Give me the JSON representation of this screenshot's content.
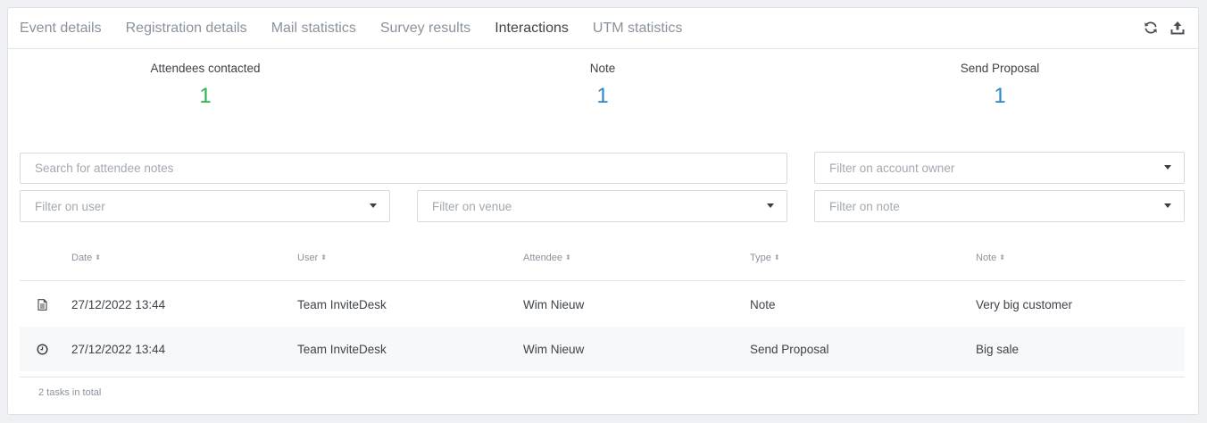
{
  "tabs": [
    {
      "label": "Event details",
      "active": false
    },
    {
      "label": "Registration details",
      "active": false
    },
    {
      "label": "Mail statistics",
      "active": false
    },
    {
      "label": "Survey results",
      "active": false
    },
    {
      "label": "Interactions",
      "active": true
    },
    {
      "label": "UTM statistics",
      "active": false
    }
  ],
  "actions": {
    "refresh_icon": "refresh-icon",
    "export_icon": "upload-icon"
  },
  "stats": [
    {
      "label": "Attendees contacted",
      "value": "1",
      "color": "#2bb24c"
    },
    {
      "label": "Note",
      "value": "1",
      "color": "#2a86c7"
    },
    {
      "label": "Send Proposal",
      "value": "1",
      "color": "#2a86c7"
    }
  ],
  "filters": {
    "search_placeholder": "Search for attendee notes",
    "account_owner": "Filter on account owner",
    "user": "Filter on user",
    "venue": "Filter on venue",
    "note": "Filter on note"
  },
  "table": {
    "columns": [
      "Date",
      "User",
      "Attendee",
      "Type",
      "Note"
    ],
    "rows": [
      {
        "icon": "document-icon",
        "date": "27/12/2022 13:44",
        "user": "Team InviteDesk",
        "attendee": "Wim Nieuw",
        "type": "Note",
        "note": "Very big customer"
      },
      {
        "icon": "clock-icon",
        "date": "27/12/2022 13:44",
        "user": "Team InviteDesk",
        "attendee": "Wim Nieuw",
        "type": "Send Proposal",
        "note": "Big sale"
      }
    ],
    "footer": "2 tasks in total"
  }
}
